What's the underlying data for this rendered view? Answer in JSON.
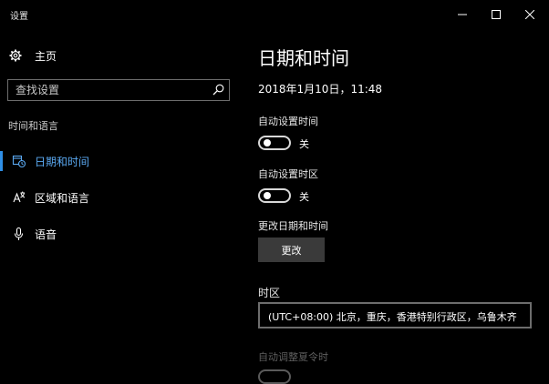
{
  "window": {
    "title": "设置",
    "minimize_icon": "minimize-icon",
    "maximize_icon": "maximize-icon",
    "close_icon": "close-icon"
  },
  "sidebar": {
    "home_label": "主页",
    "home_icon": "gear-icon",
    "search": {
      "placeholder": "查找设置",
      "value": "",
      "icon": "search-icon"
    },
    "section_title": "时间和语言",
    "items": [
      {
        "label": "日期和时间",
        "icon": "calendar-clock-icon",
        "active": true
      },
      {
        "label": "区域和语言",
        "icon": "language-icon",
        "active": false
      },
      {
        "label": "语音",
        "icon": "microphone-icon",
        "active": false
      }
    ]
  },
  "main": {
    "title": "日期和时间",
    "current_datetime": "2018年1月10日，11:48",
    "auto_time": {
      "label": "自动设置时间",
      "state": "关"
    },
    "auto_timezone": {
      "label": "自动设置时区",
      "state": "关"
    },
    "change": {
      "label": "更改日期和时间",
      "button": "更改"
    },
    "timezone": {
      "label": "时区",
      "value": "(UTC+08:00) 北京，重庆，香港特别行政区，乌鲁木齐"
    },
    "dst": {
      "label": "自动调整夏令时"
    }
  },
  "colors": {
    "background": "#000000",
    "accent": "#2f8fe6",
    "active_text": "#5aa8f0",
    "button_bg": "#3a3a3a",
    "disabled_text": "#5f5f5f"
  }
}
